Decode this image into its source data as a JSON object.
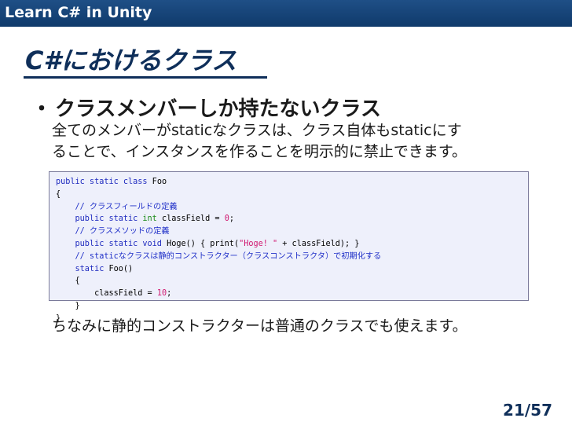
{
  "header": {
    "title": "Learn C# in Unity"
  },
  "slide": {
    "title": "C#におけるクラス",
    "bullet": "クラスメンバーしか持たないクラス",
    "bullet_mark": "・",
    "desc_line1": "全てのメンバーがstaticなクラスは、クラス自体もstaticにす",
    "desc_line2": "ることで、インスタンスを作ることを明示的に禁止できます。",
    "footer_note": "ちなみに静的コンストラクターは普通のクラスでも使えます。",
    "page": "21/57"
  },
  "code": {
    "l1_kw": "public static class",
    "l1_rest": " Foo",
    "l2": "{",
    "l3_cm": "    // クラスフィールドの定義",
    "l4_kw": "    public static",
    "l4_ty": " int",
    "l4_rest": " classField = ",
    "l4_num": "0",
    "l4_end": ";",
    "l5_cm": "    // クラスメソッドの定義",
    "l6_kw": "    public static void",
    "l6_a": " Hoge() { print(",
    "l6_str": "\"Hoge! \"",
    "l6_b": " + classField); }",
    "l7_cm": "    // staticなクラスは静的コンストラクター（クラスコンストラクタ）で初期化する",
    "l8_kw": "    static",
    "l8_rest": " Foo()",
    "l9": "    {",
    "l10_a": "        classField = ",
    "l10_num": "10",
    "l10_end": ";",
    "l11": "    }",
    "l12": "}"
  }
}
